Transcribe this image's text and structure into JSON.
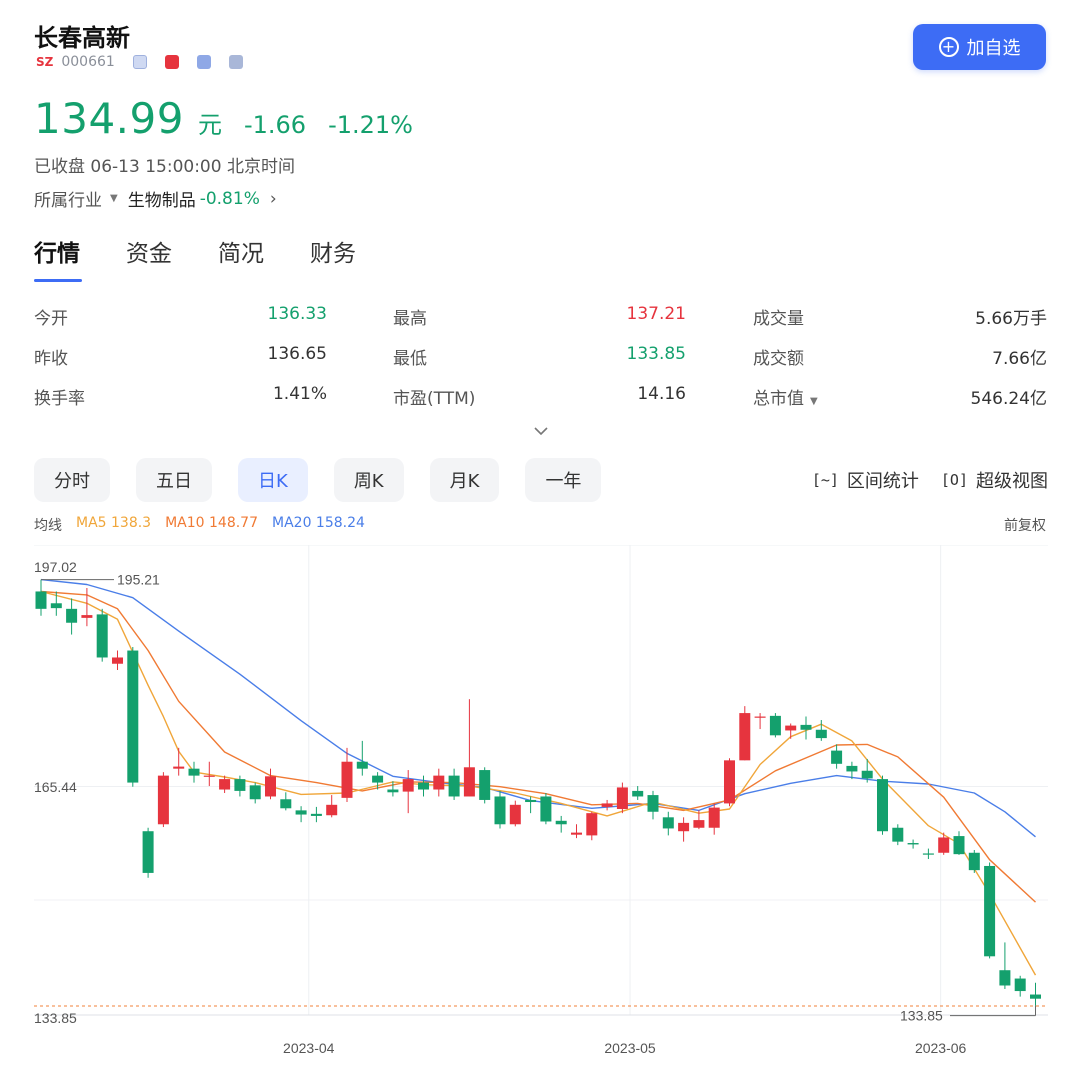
{
  "stock": {
    "name": "长春高新",
    "market": "SZ",
    "code": "000661",
    "price": "134.99",
    "unit": "元",
    "change": "-1.66",
    "change_pct": "-1.21%",
    "status": "已收盘 06-13 15:00:00 北京时间",
    "industry_label": "所属行业",
    "industry_name": "生物制品",
    "industry_pct": "-0.81%",
    "add_label": "加自选"
  },
  "tabs": [
    "行情",
    "资金",
    "简况",
    "财务"
  ],
  "stats": [
    [
      {
        "label": "今开",
        "value": "136.33",
        "color": "green"
      },
      {
        "label": "最高",
        "value": "137.21",
        "color": "red"
      },
      {
        "label": "成交量",
        "value": "5.66万手",
        "color": "dark"
      }
    ],
    [
      {
        "label": "昨收",
        "value": "136.65",
        "color": "dark"
      },
      {
        "label": "最低",
        "value": "133.85",
        "color": "green"
      },
      {
        "label": "成交额",
        "value": "7.66亿",
        "color": "dark"
      }
    ],
    [
      {
        "label": "换手率",
        "value": "1.41%",
        "color": "dark"
      },
      {
        "label": "市盈(TTM)",
        "value": "14.16",
        "color": "dark"
      },
      {
        "label": "总市值",
        "value": "546.24亿",
        "color": "dark"
      }
    ]
  ],
  "periods": [
    "分时",
    "五日",
    "日K",
    "周K",
    "月K",
    "一年"
  ],
  "tools": {
    "range": "区间统计",
    "super": "超级视图",
    "range_icon": "[~]",
    "super_icon": "[O]"
  },
  "ma": {
    "label": "均线",
    "ma5": "MA5 138.3",
    "ma10": "MA10 148.77",
    "ma20": "MA20 158.24",
    "adjust": "前复权"
  },
  "chart_data": {
    "type": "candlestick",
    "x_ticks": [
      "2023-04",
      "2023-05",
      "2023-06"
    ],
    "y_ticks": [
      "197.02",
      "165.44",
      "133.85"
    ],
    "max_label": "195.21",
    "min_label": "133.85",
    "ylim": [
      133.85,
      197.02
    ],
    "colors": {
      "up": "#e6343e",
      "down": "#14a06d",
      "ma5": "#f0a63a",
      "ma10": "#f07a34",
      "ma20": "#4a7ee8"
    },
    "candles": [
      [
        193.5,
        191.0,
        195.2,
        190.0
      ],
      [
        191.8,
        191.1,
        193.5,
        190.0
      ],
      [
        191.0,
        189.0,
        192.5,
        187.3
      ],
      [
        189.7,
        190.1,
        194.0,
        188.5
      ],
      [
        190.2,
        184.0,
        191.0,
        183.4
      ],
      [
        183.1,
        184.0,
        185.0,
        182.2
      ],
      [
        185.0,
        166.0,
        185.5,
        165.4
      ],
      [
        159.0,
        153.0,
        159.5,
        152.3
      ],
      [
        160.0,
        167.0,
        167.5,
        159.6
      ],
      [
        168.0,
        168.3,
        171.0,
        167.0
      ],
      [
        168.0,
        167.0,
        169.0,
        166.0
      ],
      [
        167.0,
        167.0,
        169.0,
        165.5
      ],
      [
        165.0,
        166.5,
        167.0,
        164.5
      ],
      [
        166.5,
        164.8,
        167.0,
        164.0
      ],
      [
        165.6,
        163.6,
        166.0,
        163.0
      ],
      [
        164.0,
        166.9,
        168.0,
        163.6
      ],
      [
        163.6,
        162.3,
        164.6,
        162.0
      ],
      [
        162.0,
        161.4,
        162.6,
        160.3
      ],
      [
        161.5,
        161.2,
        162.5,
        160.3
      ],
      [
        161.3,
        162.8,
        164.2,
        161.0
      ],
      [
        163.8,
        169.0,
        171.0,
        163.2
      ],
      [
        169.0,
        168.0,
        172.0,
        167.0
      ],
      [
        167.0,
        166.0,
        167.5,
        165.0
      ],
      [
        165.0,
        164.6,
        166.2,
        164.0
      ],
      [
        164.7,
        166.5,
        167.8,
        161.6
      ],
      [
        166.0,
        165.0,
        167.0,
        164.0
      ],
      [
        165.0,
        167.0,
        168.0,
        164.0
      ],
      [
        167.0,
        164.0,
        168.0,
        163.5
      ],
      [
        164.0,
        168.2,
        178.0,
        164.0
      ],
      [
        167.8,
        163.5,
        168.2,
        163.0
      ],
      [
        164.0,
        160.0,
        164.8,
        159.4
      ],
      [
        160.0,
        162.8,
        163.4,
        159.7
      ],
      [
        163.5,
        163.2,
        164.0,
        161.6
      ],
      [
        164.0,
        160.4,
        164.5,
        160.0
      ],
      [
        160.5,
        160.0,
        161.2,
        158.8
      ],
      [
        158.5,
        158.8,
        160.0,
        158.0
      ],
      [
        158.4,
        161.6,
        161.8,
        157.7
      ],
      [
        162.5,
        163.0,
        163.5,
        162.0
      ],
      [
        162.2,
        165.3,
        166.0,
        161.6
      ],
      [
        164.8,
        164.0,
        165.5,
        163.5
      ],
      [
        164.2,
        161.8,
        164.8,
        160.7
      ],
      [
        161.0,
        159.4,
        161.8,
        158.4
      ],
      [
        159.0,
        160.2,
        161.0,
        157.5
      ],
      [
        159.5,
        160.6,
        162.0,
        159.3
      ],
      [
        159.5,
        162.4,
        163.0,
        158.5
      ],
      [
        163.0,
        169.2,
        169.5,
        162.6
      ],
      [
        169.2,
        176.0,
        177.0,
        169.2
      ],
      [
        175.4,
        175.5,
        176.0,
        173.7
      ],
      [
        175.6,
        172.8,
        176.0,
        172.5
      ],
      [
        173.5,
        174.2,
        174.5,
        172.3
      ],
      [
        174.3,
        173.6,
        175.5,
        172.2
      ],
      [
        173.6,
        172.4,
        175.0,
        172.0
      ],
      [
        170.6,
        168.7,
        171.5,
        168.0
      ],
      [
        168.4,
        167.6,
        169.0,
        166.5
      ],
      [
        167.7,
        166.6,
        169.4,
        166.0
      ],
      [
        166.5,
        159.0,
        167.0,
        158.5
      ],
      [
        159.5,
        157.5,
        160.0,
        157.0
      ],
      [
        157.3,
        157.1,
        157.8,
        156.5
      ],
      [
        155.8,
        155.7,
        156.5,
        155.0
      ],
      [
        155.9,
        158.1,
        158.8,
        155.6
      ],
      [
        158.3,
        155.7,
        159.0,
        155.6
      ],
      [
        155.9,
        153.4,
        156.3,
        153.0
      ],
      [
        154.0,
        141.0,
        154.5,
        140.7
      ],
      [
        139.0,
        136.8,
        143.0,
        136.3
      ],
      [
        137.8,
        136.0,
        138.2,
        135.2
      ],
      [
        135.5,
        134.9,
        137.2,
        133.9
      ]
    ],
    "ma5": [
      [
        0,
        193.5
      ],
      [
        3,
        191.8
      ],
      [
        5,
        189.5
      ],
      [
        7,
        180.0
      ],
      [
        8,
        175.5
      ],
      [
        9,
        170.5
      ],
      [
        10,
        167.5
      ],
      [
        12,
        166.8
      ],
      [
        14,
        166.0
      ],
      [
        17,
        164.3
      ],
      [
        20,
        164.5
      ],
      [
        23,
        166.1
      ],
      [
        25,
        165.7
      ],
      [
        28,
        165.5
      ],
      [
        31,
        164.5
      ],
      [
        34,
        163.0
      ],
      [
        37,
        161.2
      ],
      [
        40,
        163.2
      ],
      [
        43,
        161.6
      ],
      [
        45,
        162.2
      ],
      [
        47,
        168.6
      ],
      [
        49,
        172.6
      ],
      [
        51,
        174.4
      ],
      [
        53,
        172.0
      ],
      [
        55,
        166.5
      ],
      [
        58,
        159.8
      ],
      [
        60,
        157.2
      ],
      [
        62,
        150.0
      ],
      [
        65,
        138.3
      ]
    ],
    "ma10": [
      [
        0,
        193.5
      ],
      [
        3,
        193.0
      ],
      [
        5,
        191.0
      ],
      [
        7,
        185.0
      ],
      [
        9,
        177.7
      ],
      [
        12,
        170.4
      ],
      [
        15,
        167.0
      ],
      [
        18,
        166.0
      ],
      [
        21,
        164.8
      ],
      [
        24,
        166.1
      ],
      [
        27,
        166.0
      ],
      [
        30,
        165.4
      ],
      [
        33,
        164.4
      ],
      [
        36,
        162.8
      ],
      [
        39,
        163.0
      ],
      [
        42,
        162.0
      ],
      [
        45,
        163.5
      ],
      [
        48,
        167.7
      ],
      [
        52,
        171.4
      ],
      [
        54,
        171.5
      ],
      [
        56,
        169.7
      ],
      [
        59,
        163.9
      ],
      [
        62,
        154.9
      ],
      [
        65,
        148.8
      ]
    ],
    "ma20": [
      [
        0,
        195.2
      ],
      [
        3,
        194.5
      ],
      [
        6,
        192.6
      ],
      [
        9,
        187.8
      ],
      [
        13,
        181.6
      ],
      [
        17,
        174.9
      ],
      [
        20,
        170.2
      ],
      [
        23,
        166.9
      ],
      [
        26,
        166.0
      ],
      [
        29,
        165.3
      ],
      [
        32,
        163.4
      ],
      [
        36,
        162.3
      ],
      [
        40,
        163.0
      ],
      [
        43,
        162.0
      ],
      [
        46,
        164.4
      ],
      [
        49,
        165.9
      ],
      [
        52,
        167.0
      ],
      [
        55,
        166.2
      ],
      [
        58,
        165.8
      ],
      [
        61,
        164.5
      ],
      [
        63,
        161.8
      ],
      [
        65,
        158.2
      ]
    ]
  }
}
